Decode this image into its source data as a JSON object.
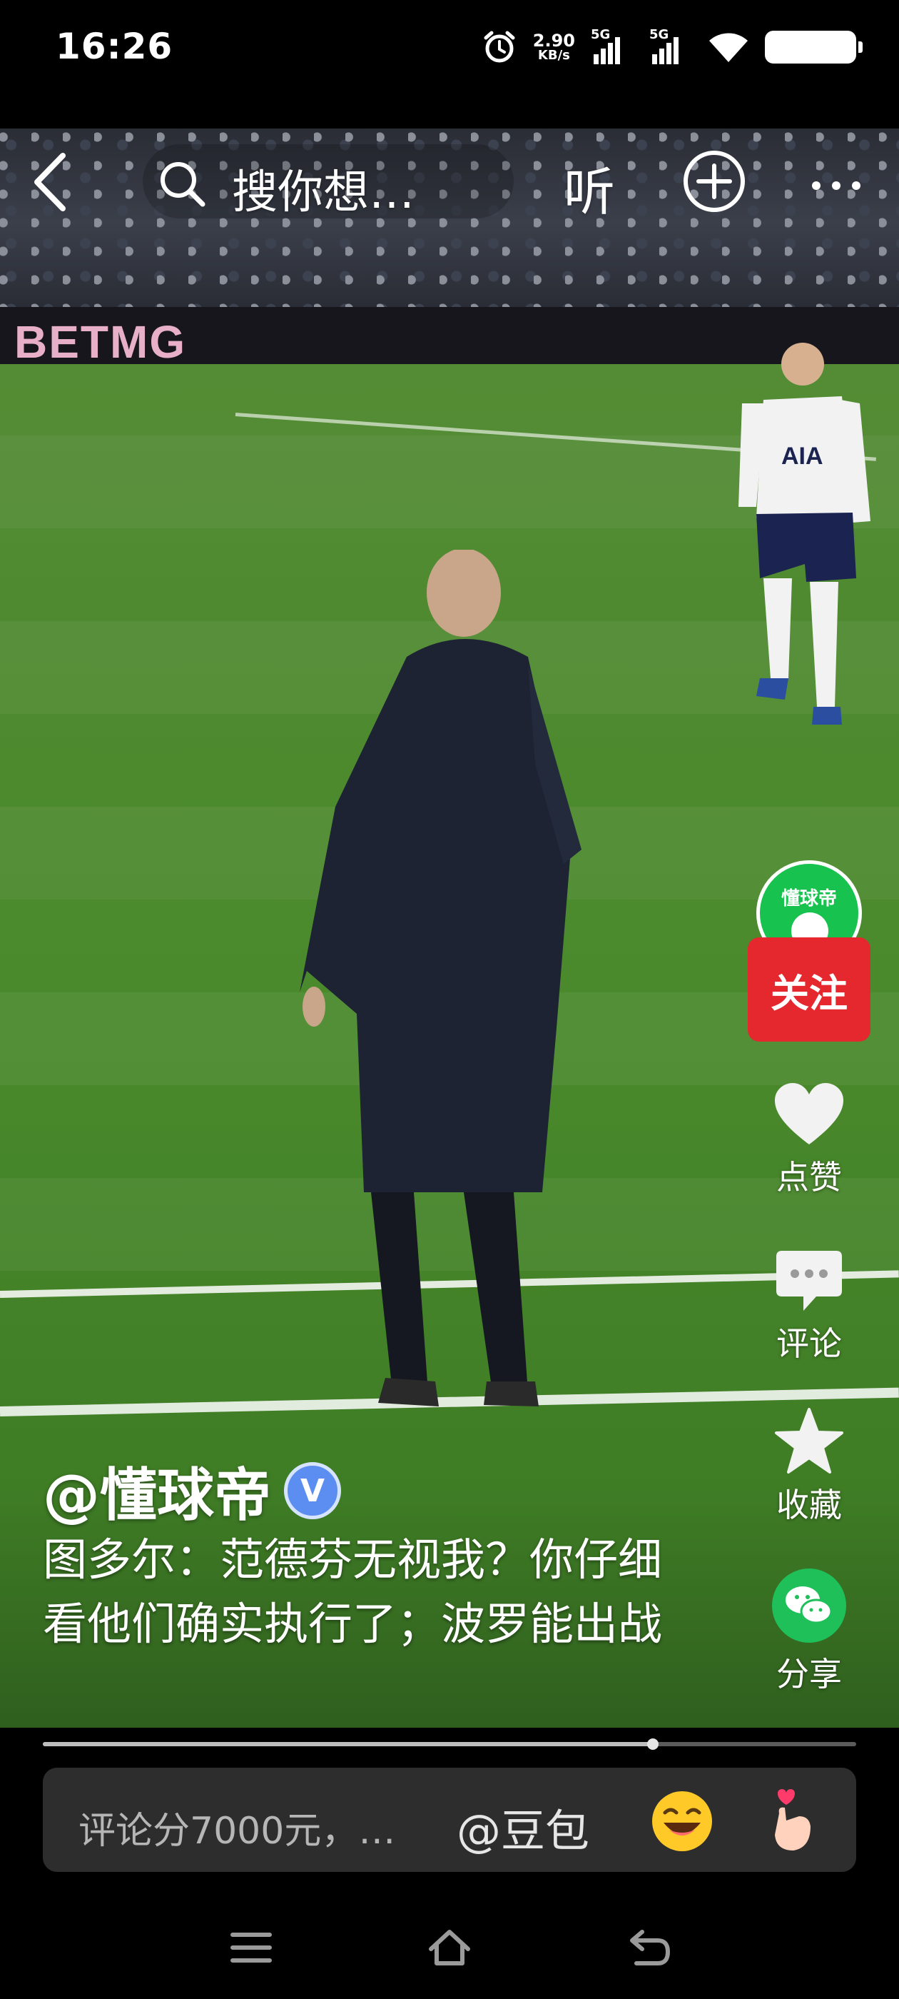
{
  "status_bar": {
    "time": "16:26",
    "net_speed_value": "2.90",
    "net_speed_unit": "KB/s",
    "signal1_label": "5G",
    "signal2_label": "5G",
    "icons": [
      "alarm-icon",
      "signal-5g-icon",
      "signal-5g-icon",
      "wifi-icon",
      "battery-icon"
    ]
  },
  "video_scene": {
    "ad_board_text": "BETMG"
  },
  "top_bar": {
    "search_placeholder": "搜你想…",
    "listen_label": "听",
    "icons": [
      "back-icon",
      "search-icon",
      "plus-icon",
      "more-icon"
    ]
  },
  "side_actions": {
    "avatar_text": "懂球帝",
    "follow_label": "关注",
    "like_label": "点赞",
    "comment_label": "评论",
    "favorite_label": "收藏",
    "share_label": "分享"
  },
  "post": {
    "author": "@懂球帝",
    "verified_label": "V",
    "caption": "图多尔：范德芬无视我？你仔细看他们确实执行了；波罗能出战"
  },
  "playback": {
    "progress": 0.75
  },
  "comment_bar": {
    "placeholder": "评论分7000元，…",
    "mention_label": "@豆包"
  },
  "nav_bar": {
    "icons": [
      "menu-icon",
      "home-icon",
      "back-nav-icon"
    ]
  },
  "colors": {
    "follow_button": "#e5272e",
    "avatar_bg": "#17c24e",
    "verified_badge": "#5b8ef0",
    "share_icon": "#1fbf5a",
    "comment_bar_bg": "#2d2d2d"
  }
}
